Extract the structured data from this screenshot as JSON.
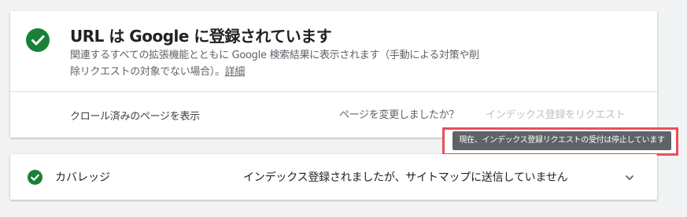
{
  "status_card": {
    "title": "URL は Google に登録されています",
    "description": "関連するすべての拡張機能とともに Google 検索結果に表示されます（手動による対策や削除リクエストの対象でない場合）。",
    "details_link": "詳細",
    "view_crawled_link": "クロール済みのページを表示",
    "page_changed_prompt": "ページを変更しましたか？",
    "request_indexing_button": "インデックス登録をリクエスト",
    "status_icon": "check-circle-icon",
    "status_color": "#188038"
  },
  "tooltip": {
    "text": "現在、インデックス登録リクエストの受付は停止しています",
    "highlight_color": "#e8505b"
  },
  "coverage": {
    "label": "カバレッジ",
    "status": "インデックス登録されましたが、サイトマップに送信していません",
    "status_icon": "check-circle-icon",
    "expand_icon": "chevron-down-icon"
  }
}
